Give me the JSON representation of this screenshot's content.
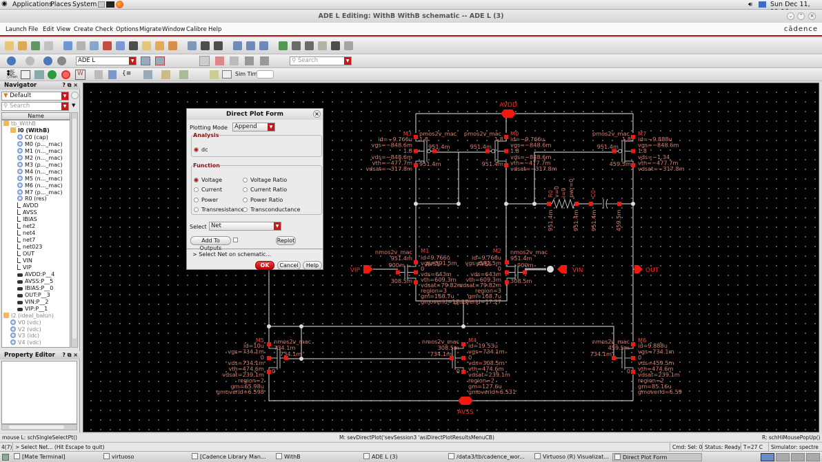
{
  "top_panel": {
    "menus": [
      "Applications",
      "Places",
      "System"
    ],
    "clock": "Sun Dec 11, 11:10"
  },
  "window": {
    "title": "ADE L Editing: WithB WithB schematic -- ADE L (3)",
    "brand": "cādence"
  },
  "menu": [
    "Launch",
    "File",
    "Edit",
    "View",
    "Create",
    "Check",
    "Options",
    "Migrate",
    "Window",
    "Calibre",
    "Help"
  ],
  "toolbar": {
    "row1_icons": [
      "new-icon",
      "open-icon",
      "save-check-icon",
      "save-icon",
      "move-icon",
      "copy-icon",
      "stretch-icon",
      "delete-icon",
      "properties-icon",
      "text-icon",
      "label-icon",
      "undo-icon",
      "redo-icon",
      "zoom-fit-icon",
      "font-up-icon",
      "font-down-icon",
      "zoom-in-icon",
      "zoom-out-icon",
      "zoom-box-icon",
      "add-instance-icon",
      "wire-icon",
      "wide-wire-icon",
      "wire-name-icon",
      "pin-icon",
      "check-save-icon"
    ],
    "workspace": "ADE L",
    "search_placeholder": "Search",
    "sim_time_label": "Sim Time",
    "sim_time_value": ""
  },
  "navigator": {
    "title": "Navigator",
    "filter": "Default",
    "search_placeholder": "Search",
    "column": "Name",
    "items": [
      {
        "label": "tb_WithB",
        "level": 0,
        "icon": "folder",
        "dim": true
      },
      {
        "label": "I0 (WithB)",
        "level": 1,
        "icon": "folder",
        "bold": true
      },
      {
        "label": "C0 (cap)",
        "level": 2,
        "icon": "instance"
      },
      {
        "label": "M0 (p..._mac)",
        "level": 2,
        "icon": "instance"
      },
      {
        "label": "M1 (n..._mac)",
        "level": 2,
        "icon": "instance"
      },
      {
        "label": "M2 (n..._mac)",
        "level": 2,
        "icon": "instance"
      },
      {
        "label": "M3 (p..._mac)",
        "level": 2,
        "icon": "instance"
      },
      {
        "label": "M4 (n..._mac)",
        "level": 2,
        "icon": "instance"
      },
      {
        "label": "M5 (n..._mac)",
        "level": 2,
        "icon": "instance"
      },
      {
        "label": "M6 (n..._mac)",
        "level": 2,
        "icon": "instance"
      },
      {
        "label": "M7 (p..._mac)",
        "level": 2,
        "icon": "instance"
      },
      {
        "label": "R0 (res)",
        "level": 2,
        "icon": "instance"
      },
      {
        "label": "AVDD",
        "level": 2,
        "icon": "net"
      },
      {
        "label": "AVSS",
        "level": 2,
        "icon": "net"
      },
      {
        "label": "IBIAS",
        "level": 2,
        "icon": "net"
      },
      {
        "label": "net2",
        "level": 2,
        "icon": "net"
      },
      {
        "label": "net4",
        "level": 2,
        "icon": "net"
      },
      {
        "label": "net7",
        "level": 2,
        "icon": "net"
      },
      {
        "label": "net023",
        "level": 2,
        "icon": "net"
      },
      {
        "label": "OUT",
        "level": 2,
        "icon": "net"
      },
      {
        "label": "VIN",
        "level": 2,
        "icon": "net"
      },
      {
        "label": "VIP",
        "level": 2,
        "icon": "net"
      },
      {
        "label": "AVDD:P__4",
        "level": 2,
        "icon": "terminal"
      },
      {
        "label": "AVSS:P__5",
        "level": 2,
        "icon": "terminal"
      },
      {
        "label": "IBIAS:P__0",
        "level": 2,
        "icon": "terminal"
      },
      {
        "label": "OUT:P__3",
        "level": 2,
        "icon": "terminal"
      },
      {
        "label": "VIN:P__2",
        "level": 2,
        "icon": "terminal"
      },
      {
        "label": "VIP:P__1",
        "level": 2,
        "icon": "terminal"
      },
      {
        "label": "I2 (ideal_balun)",
        "level": 0,
        "icon": "folder",
        "dim": true
      },
      {
        "label": "V0 (vdc)",
        "level": 1,
        "icon": "instance",
        "dim": true
      },
      {
        "label": "V2 (vdc)",
        "level": 1,
        "icon": "instance",
        "dim": true
      },
      {
        "label": "V3 (idc)",
        "level": 1,
        "icon": "instance",
        "dim": true
      },
      {
        "label": "V4 (vdc)",
        "level": 1,
        "icon": "instance",
        "dim": true
      }
    ]
  },
  "property_editor": {
    "title": "Property Editor"
  },
  "dialog": {
    "title": "Direct Plot Form",
    "plotting_mode_label": "Plotting Mode",
    "plotting_mode": "Append",
    "analysis_label": "Analysis",
    "analysis_options": [
      {
        "label": "dc",
        "selected": true
      }
    ],
    "function_label": "Function",
    "function_options": [
      {
        "label": "Voltage",
        "selected": true
      },
      {
        "label": "Voltage Ratio",
        "selected": false
      },
      {
        "label": "Current",
        "selected": false
      },
      {
        "label": "Current Ratio",
        "selected": false
      },
      {
        "label": "Power",
        "selected": false
      },
      {
        "label": "Power Ratio",
        "selected": false
      },
      {
        "label": "Transresistance",
        "selected": false
      },
      {
        "label": "Transconductance",
        "selected": false
      }
    ],
    "select_label": "Select",
    "select_value": "Net",
    "add_to_outputs": "Add To Outputs",
    "add_to_outputs_checked": false,
    "replot": "Replot",
    "message": "> Select Net on schematic...",
    "ok": "OK",
    "cancel": "Cancel",
    "help": "Help"
  },
  "schematic": {
    "pins": {
      "avdd": "AVDD",
      "avss": "AVSS",
      "vip": "VIP",
      "vin": "VIN",
      "out": "OUT"
    },
    "ghost_labels": [
      "AVSS",
      "AVSS"
    ],
    "devices": {
      "M3": {
        "name": "M3",
        "model": "pmos2v_mac",
        "params": [
          "id=−9.766u",
          "vgs=−848.6m",
          "vds=−848.6m",
          "vth=−477.7m",
          "vdsat=−317.8m"
        ],
        "s": "1.8",
        "g": "951.4m",
        "d": "951.4m",
        "b": "1.8"
      },
      "M0": {
        "name": "M0",
        "model": "pmos2v_mac",
        "params": [
          "id=−9.766u",
          "vgs=−848.6m",
          "vds=−848.6m",
          "vth=−477.7m",
          "vdsat=−317.8m"
        ],
        "s": "1.8",
        "g": "951.4m",
        "d": "951.4m",
        "b": "1.8"
      },
      "M7": {
        "name": "M7",
        "model": "pmos2v_mac",
        "params": [
          "id=−9.888u",
          "vgs=−848.6m",
          "vds=−1.34",
          "vth=−477.7m",
          "vdsat=−317.8m"
        ],
        "s": "1.8",
        "g": "951.4m",
        "d": "459.5m",
        "b": "1.8"
      },
      "M1": {
        "name": "M1",
        "model": "nmos2v_mac",
        "params": [
          "id=9.766u",
          "vgs=591.5m",
          "vds=643m",
          "vth=609.3m",
          "vdsat=79.82m",
          "region=3",
          "gm=168.7u",
          "gmoverid=17.27"
        ],
        "d": "951.4m",
        "g": "900m",
        "s": "308.5m",
        "b": "0"
      },
      "M2": {
        "name": "M2",
        "model": "nmos2v_mac",
        "params": [
          "id=9.766u",
          "vgs=591.5m",
          "vds=643m",
          "vth=609.3m",
          "vdsat=79.82m",
          "region=3",
          "gm=168.7u",
          "gmoverid=17.27"
        ],
        "d": "951.4m",
        "g": "900m",
        "s": "308.5m",
        "b": "0"
      },
      "M5": {
        "name": "M5",
        "model": "nmos2v_mac",
        "params": [
          "id=10u",
          "vgs=734.1m",
          "vds=734.1m",
          "vth=474.6m",
          "vdsat=239.1m",
          "region=2",
          "gm=65.98u",
          "gmoverid=6.598"
        ],
        "d": "734.1m",
        "g": "734.1m",
        "s": "0",
        "b": "0"
      },
      "M4": {
        "name": "M4",
        "model": "nmos2v_mac",
        "params": [
          "id=19.53u",
          "vgs=734.1m",
          "vds=308.5m",
          "vth=474.6m",
          "vdsat=239.1m",
          "region=2",
          "gm=127.6u",
          "gmoverid=6.531"
        ],
        "d": "308.5m",
        "g": "734.1m",
        "s": "0",
        "b": "0"
      },
      "M6": {
        "name": "M6",
        "model": "nmos2v_mac",
        "params": [
          "id=9.888u",
          "vgs=734.1m",
          "vds=459.5m",
          "vth=474.6m",
          "vdsat=239.1m",
          "region=2",
          "gm=85.16u",
          "gmoverid=6.59"
        ],
        "d": "459.5m",
        "g": "734.1m",
        "s": "0",
        "b": "0"
      },
      "R0": {
        "name": "R0",
        "params": [
          "v=0",
          "i=0",
          "pwr=0"
        ],
        "n1": "951.4m",
        "n2": "951.4m"
      },
      "C0": {
        "name": "C0",
        "n1": "951.4m",
        "n2": "459.5m"
      }
    }
  },
  "status": {
    "mouse_l": "mouse L: schSingleSelectPt()",
    "mouse_m": "M: sevDirectPlot('sevSession3 'asiDirectPlotResultsMenuCB)",
    "mouse_r": "R: schHiMousePopUp()",
    "count": "4(7)",
    "prompt": "> Select Net... (Hit Escape to quit)",
    "cmd": "Cmd: Sel: 0",
    "state": "Status: Ready",
    "temp": "T=27  C",
    "simulator": "Simulator: spectre"
  },
  "taskbar": [
    {
      "label": "[Mate Terminal]",
      "active": false
    },
    {
      "label": "virtuoso",
      "active": false
    },
    {
      "label": "[Cadence Library Man...",
      "active": false
    },
    {
      "label": "WithB",
      "active": false
    },
    {
      "label": "ADE L (3)",
      "active": false
    },
    {
      "label": "/data3/tb/cadence_wor...",
      "active": false
    },
    {
      "label": "Virtuoso (R) Visualizat...",
      "active": false
    },
    {
      "label": "Direct Plot Form",
      "active": true
    }
  ]
}
